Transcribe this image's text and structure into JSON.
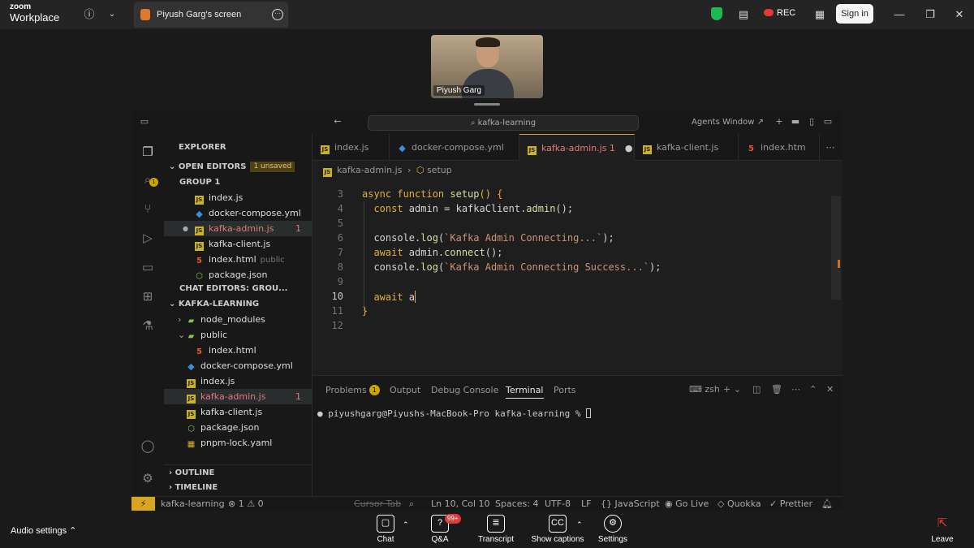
{
  "zoom": {
    "logo_line1": "zoom",
    "logo_line2": "Workplace",
    "screen_tab_title": "Piyush Garg's screen",
    "rec_label": "REC",
    "sign_in_label": "Sign in",
    "participant_name": "Piyush Garg",
    "bottom": {
      "audio_settings": "Audio settings",
      "chat": "Chat",
      "qa": "Q&A",
      "qa_badge": "99+",
      "transcript": "Transcript",
      "show_captions": "Show captions",
      "settings": "Settings",
      "leave": "Leave"
    },
    "colors": {
      "rec": "#e53935",
      "shield": "#1db954",
      "leave": "#e53935"
    }
  },
  "vscode": {
    "command_center": "kafka-learning",
    "agents_window": "Agents Window",
    "explorer": {
      "title": "EXPLORER",
      "open_editors": "OPEN EDITORS",
      "unsaved_badge": "1 unsaved",
      "group": "GROUP 1",
      "open_files": [
        {
          "name": "index.js",
          "icon": "js"
        },
        {
          "name": "docker-compose.yml",
          "icon": "yml"
        },
        {
          "name": "kafka-admin.js",
          "icon": "js",
          "count": "1"
        },
        {
          "name": "kafka-client.js",
          "icon": "js"
        },
        {
          "name": "index.html",
          "icon": "html",
          "suffix": "public"
        },
        {
          "name": "package.json",
          "icon": "json"
        }
      ],
      "chat_editors": "CHAT EDITORS: GROU...",
      "project": "KAFKA-LEARNING",
      "tree": [
        {
          "name": "node_modules",
          "icon": "folder"
        },
        {
          "name": "public",
          "icon": "folder"
        },
        {
          "name": "index.html",
          "icon": "html"
        },
        {
          "name": "docker-compose.yml",
          "icon": "yml"
        },
        {
          "name": "index.js",
          "icon": "js"
        },
        {
          "name": "kafka-admin.js",
          "icon": "js",
          "count": "1"
        },
        {
          "name": "kafka-client.js",
          "icon": "js"
        },
        {
          "name": "package.json",
          "icon": "json"
        },
        {
          "name": "pnpm-lock.yaml",
          "icon": "lock"
        }
      ],
      "outline": "OUTLINE",
      "timeline": "TIMELINE"
    },
    "tabs": [
      {
        "name": "index.js"
      },
      {
        "name": "docker-compose.yml"
      },
      {
        "name": "kafka-admin.js 1"
      },
      {
        "name": "kafka-client.js"
      },
      {
        "name": "index.htm"
      }
    ],
    "breadcrumb": {
      "file": "kafka-admin.js",
      "symbol": "setup"
    },
    "editor": {
      "line_numbers": [
        "3",
        "4",
        "5",
        "6",
        "7",
        "8",
        "9",
        "10",
        "11",
        "12"
      ],
      "current_line": "10",
      "lines": [
        [
          {
            "t": "async function ",
            "c": "kw"
          },
          {
            "t": "setup",
            "c": "fn"
          },
          {
            "t": "() {",
            "c": "pun"
          }
        ],
        [
          {
            "t": "  const ",
            "c": "kw"
          },
          {
            "t": "admin = kafkaClient.",
            "c": ""
          },
          {
            "t": "admin",
            "c": "fn"
          },
          {
            "t": "();",
            "c": ""
          }
        ],
        [],
        [
          {
            "t": "  console.",
            "c": ""
          },
          {
            "t": "log",
            "c": "fn"
          },
          {
            "t": "(",
            "c": ""
          },
          {
            "t": "`Kafka Admin Connecting...`",
            "c": "str"
          },
          {
            "t": ");",
            "c": ""
          }
        ],
        [
          {
            "t": "  await ",
            "c": "kw"
          },
          {
            "t": "admin.",
            "c": ""
          },
          {
            "t": "connect",
            "c": "fn"
          },
          {
            "t": "();",
            "c": ""
          }
        ],
        [
          {
            "t": "  console.",
            "c": ""
          },
          {
            "t": "log",
            "c": "fn"
          },
          {
            "t": "(",
            "c": ""
          },
          {
            "t": "`Kafka Admin Connecting Success...`",
            "c": "str"
          },
          {
            "t": ");",
            "c": ""
          }
        ],
        [],
        [
          {
            "t": "  await ",
            "c": "kw"
          },
          {
            "t": "a",
            "c": ""
          }
        ],
        [
          {
            "t": "}",
            "c": "pun"
          }
        ],
        []
      ]
    },
    "panel": {
      "tabs": [
        "Problems",
        "Output",
        "Debug Console",
        "Terminal",
        "Ports"
      ],
      "problems_count": "1",
      "shell": "zsh",
      "terminal_prompt": "piyushgarg@Piyushs-MacBook-Pro kafka-learning % "
    },
    "status": {
      "remote": "⚡",
      "branch": "kafka-learning",
      "errors": "⊗ 1 ⚠ 0",
      "cursor_tab": "Cursor Tab",
      "position": "Ln 10, Col 10",
      "spaces": "Spaces: 4",
      "encoding": "UTF-8",
      "eol": "LF",
      "language": "{} JavaScript",
      "golive": "Go Live",
      "quokka": "Quokka",
      "prettier": "✓ Prettier"
    }
  }
}
